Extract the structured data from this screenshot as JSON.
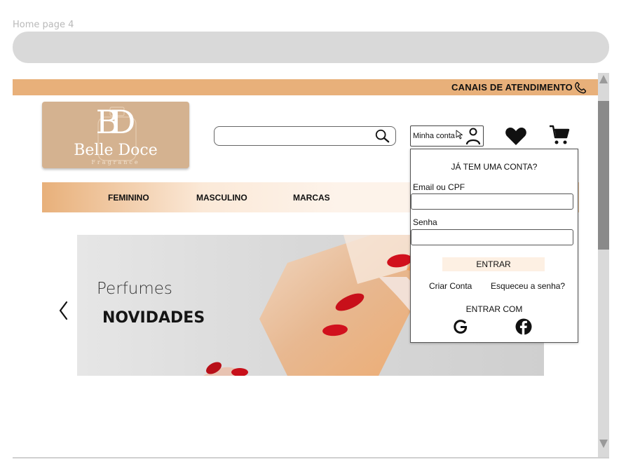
{
  "frame_label": "Home page 4",
  "topbar": {
    "service_text": "CANAIS DE ATENDIMENTO",
    "icon": "phone-icon"
  },
  "logo": {
    "monogram": "BD",
    "name": "Belle Doce",
    "subtitle": "Fragrance"
  },
  "search": {
    "placeholder": "",
    "icon": "search-icon"
  },
  "account": {
    "label": "Minha conta",
    "icons": [
      "cursor-icon",
      "user-icon"
    ]
  },
  "wishlist": {
    "icon": "heart-icon"
  },
  "cart": {
    "icon": "cart-icon"
  },
  "nav": {
    "items": [
      "FEMININO",
      "MASCULINO",
      "MARCAS"
    ]
  },
  "hero": {
    "small_text": "Perfumes",
    "big_text": "NOVIDADES",
    "prev_icon": "chevron-left-icon"
  },
  "login": {
    "title": "JÁ TEM UMA CONTA?",
    "email_label": "Email ou CPF",
    "email_value": "",
    "password_label": "Senha",
    "password_value": "",
    "enter_label": "ENTRAR",
    "create_account": "Criar Conta",
    "forgot_password": "Esqueceu a senha?",
    "enter_with": "ENTRAR COM",
    "social": [
      "google-icon",
      "facebook-icon"
    ]
  },
  "colors": {
    "brand_orange": "#e8b07a",
    "logo_bg": "#d4b290",
    "button_bg": "#fdf0e3",
    "scroll_thumb": "#8a8a8a"
  }
}
